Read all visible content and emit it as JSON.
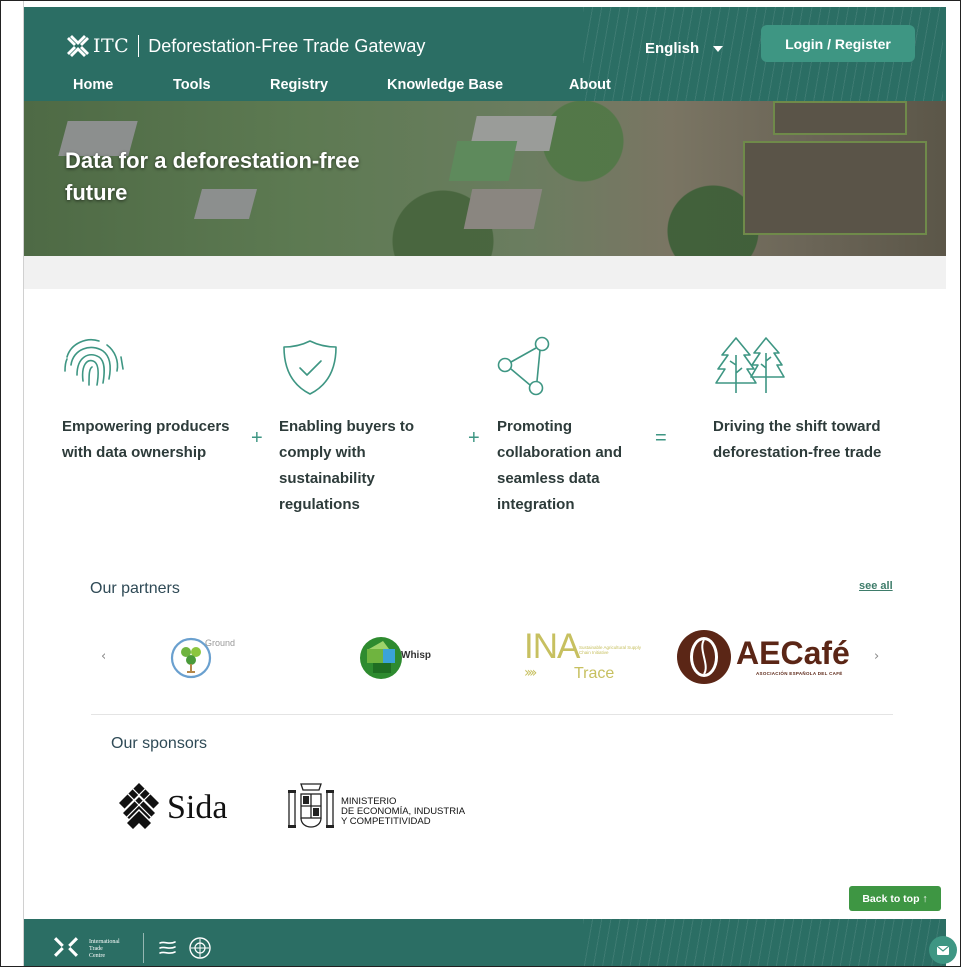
{
  "header": {
    "logo_text": "ITC",
    "app_title": "Deforestation-Free Trade Gateway",
    "language": "English",
    "login_label": "Login / Register",
    "nav": [
      "Home",
      "Tools",
      "Registry",
      "Knowledge Base",
      "About"
    ]
  },
  "hero": {
    "title": "Data for a deforestation-free future"
  },
  "features": [
    {
      "icon": "fingerprint-icon",
      "text": "Empowering producers with data ownership"
    },
    {
      "icon": "shield-check-icon",
      "text": "Enabling buyers to comply with sustainability regulations"
    },
    {
      "icon": "network-icon",
      "text": "Promoting collaboration and seamless data integration"
    },
    {
      "icon": "trees-icon",
      "text": "Driving the shift toward deforestation-free trade"
    }
  ],
  "operators": [
    "+",
    "+",
    "="
  ],
  "partners": {
    "title": "Our partners",
    "see_all": "see all",
    "logos": {
      "ground": "Ground",
      "whisp": "Whisp",
      "ina_main": "INA",
      "ina_sub": "Sustainable Agricultural Supply Chain Initiative",
      "ina_trace": "Trace",
      "aecafe": "AECafé",
      "aecafe_sub": "ASOCIACIÓN ESPAÑOLA DEL CAFÉ"
    }
  },
  "sponsors": {
    "title": "Our sponsors",
    "sida": "Sida",
    "ministry_lines": [
      "MINISTERIO",
      "DE ECONOMÍA, INDUSTRIA",
      "Y COMPETITIVIDAD"
    ]
  },
  "back_to_top": "Back to top ↑",
  "footer": {
    "itc_lines": [
      "International",
      "Trade",
      "Centre"
    ]
  },
  "colors": {
    "header_bg": "#2b6e64",
    "accent": "#3e9683",
    "back_to_top_bg": "#3e9643"
  }
}
